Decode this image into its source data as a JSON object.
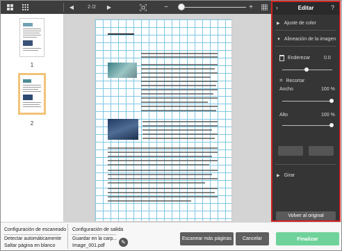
{
  "toolbar": {
    "page_counter": "2 /2",
    "icons": [
      "grid-small-icon",
      "grid-large-icon",
      "chevron-left-icon",
      "chevron-right-icon",
      "fit-page-icon",
      "zoom-out-icon",
      "zoom-in-icon",
      "grid-icon"
    ]
  },
  "thumbnails": [
    {
      "label": "1"
    },
    {
      "label": "2"
    }
  ],
  "panel": {
    "title": "Editar",
    "help_icon": "question-icon",
    "sections": {
      "color": "Ajuste de color",
      "align": "Alineación de la imagen",
      "rotate": "Girar"
    },
    "straighten_label": "Enderezar",
    "straighten_value": "0.0",
    "crop_label": "Recortar",
    "width_label": "Ancho",
    "width_value": "100 %",
    "height_label": "Alto",
    "height_value": "100 %",
    "restore_button": "Volver al original"
  },
  "footer": {
    "scan_config": "Configuración de escaneado",
    "auto_detect": "Detectar automáticamente",
    "skip_blank": "Saltar página en blanco",
    "output_config": "Configuración de salida",
    "save_in": "Guardar en la carp...",
    "filename": "Image_001.pdf",
    "scan_more_button": "Escanear más páginas",
    "cancel_button": "Cancelar",
    "finish_button": "Finalizar"
  },
  "colors": {
    "accent_red": "#d42020",
    "finish_green": "#6fd29a",
    "selected_thumb": "#f0c27a",
    "grid_blue": "#7fc7e3"
  }
}
